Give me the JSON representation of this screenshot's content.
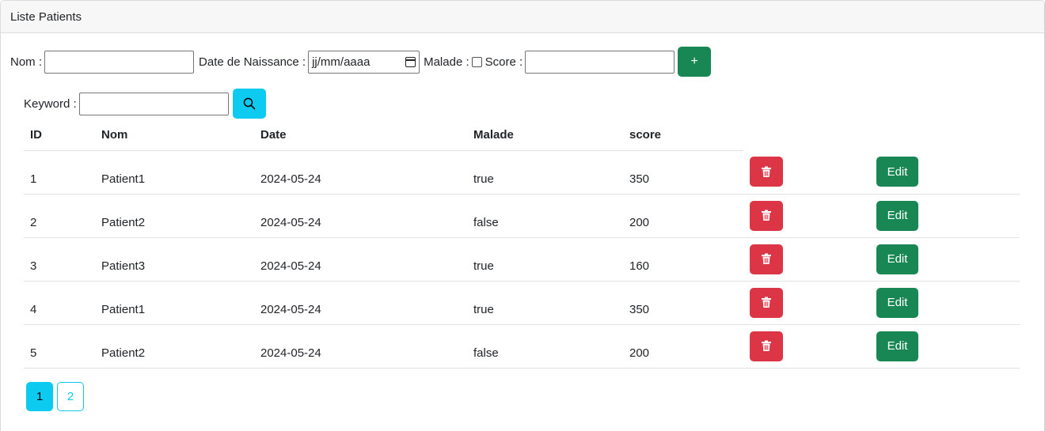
{
  "header": {
    "title": "Liste Patients"
  },
  "form": {
    "nom_label": "Nom :",
    "date_label": "Date de Naissance :",
    "date_placeholder": "jj/mm/aaaa",
    "malade_label": "Malade :",
    "score_label": "Score :",
    "add_label": "+"
  },
  "search": {
    "keyword_label": "Keyword :"
  },
  "table": {
    "headers": [
      "ID",
      "Nom",
      "Date",
      "Malade",
      "score"
    ],
    "rows": [
      [
        "1",
        "Patient1",
        "2024-05-24",
        "true",
        "350"
      ],
      [
        "2",
        "Patient2",
        "2024-05-24",
        "false",
        "200"
      ],
      [
        "3",
        "Patient3",
        "2024-05-24",
        "true",
        "160"
      ],
      [
        "4",
        "Patient1",
        "2024-05-24",
        "true",
        "350"
      ],
      [
        "5",
        "Patient2",
        "2024-05-24",
        "false",
        "200"
      ]
    ],
    "edit_label": "Edit"
  },
  "pagination": {
    "pages": [
      "1",
      "2"
    ],
    "current": "1"
  },
  "colors": {
    "success": "#198754",
    "danger": "#dc3545",
    "info": "#0dcaf0"
  }
}
